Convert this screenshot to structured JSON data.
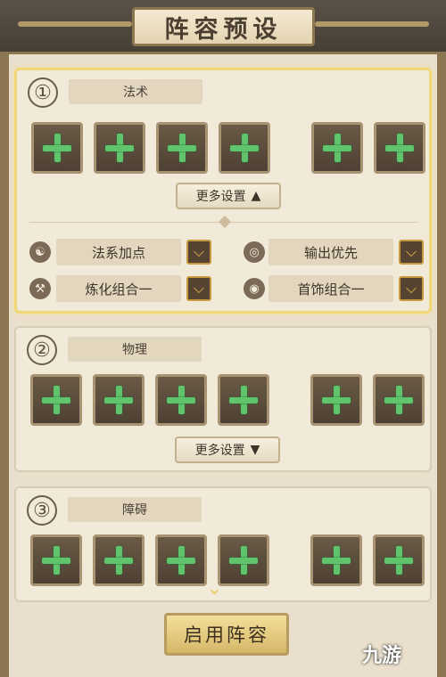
{
  "header": {
    "title": "阵容预设"
  },
  "presets": [
    {
      "number": "①",
      "name": "法术",
      "more_settings": "更多设置",
      "toggle_glyph": "▲",
      "options": [
        {
          "icon": "meditate-icon",
          "label": "法系加点"
        },
        {
          "icon": "swirl-icon",
          "label": "输出优先"
        },
        {
          "icon": "hammer-icon",
          "label": "炼化组合一"
        },
        {
          "icon": "ring-icon",
          "label": "首饰组合一"
        }
      ]
    },
    {
      "number": "②",
      "name": "物理",
      "more_settings": "更多设置",
      "toggle_glyph": "▼"
    },
    {
      "number": "③",
      "name": "障碍"
    }
  ],
  "apply_button": "启用阵容",
  "watermark": "九游",
  "colors": {
    "slot_plus": "#5fc46b",
    "active_border": "#efd777",
    "dropdown_arrow": "#f2c24e"
  }
}
